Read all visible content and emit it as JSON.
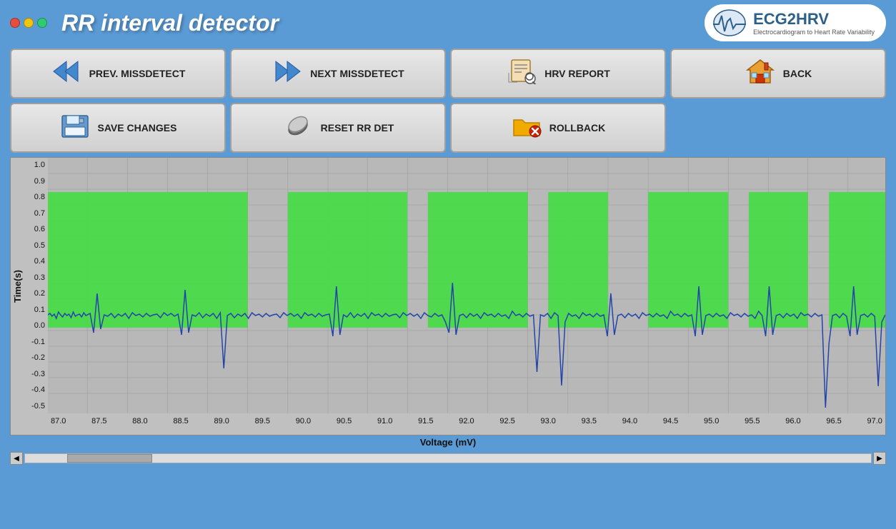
{
  "window": {
    "title": "RR interval detector"
  },
  "logo": {
    "main_text": "ECG2HRV",
    "sub_text": "Electrocardiogram to Heart Rate Variability"
  },
  "buttons": {
    "prev_missdetect": "PREV. MISSDETECT",
    "next_missdetect": "NEXT MISSDETECT",
    "hrv_report": "HRV REPORT",
    "back": "BACK",
    "save_changes": "SAVE CHANGES",
    "reset_rr_det": "RESET RR DET",
    "rollback": "ROLLBACK"
  },
  "chart": {
    "y_axis_label": "Time(s)",
    "x_axis_label": "Voltage (mV)",
    "y_ticks": [
      "1.0",
      "0.9",
      "0.8",
      "0.7",
      "0.6",
      "0.5",
      "0.4",
      "0.3",
      "0.2",
      "0.1",
      "0.0",
      "-0.1",
      "-0.2",
      "-0.3",
      "-0.4",
      "-0.5"
    ],
    "x_ticks": [
      "87.0",
      "87.5",
      "88.0",
      "88.5",
      "89.0",
      "89.5",
      "90.0",
      "90.5",
      "91.0",
      "91.5",
      "92.0",
      "92.5",
      "93.0",
      "93.5",
      "94.0",
      "94.5",
      "95.0",
      "95.5",
      "96.0",
      "96.5",
      "97.0"
    ]
  }
}
